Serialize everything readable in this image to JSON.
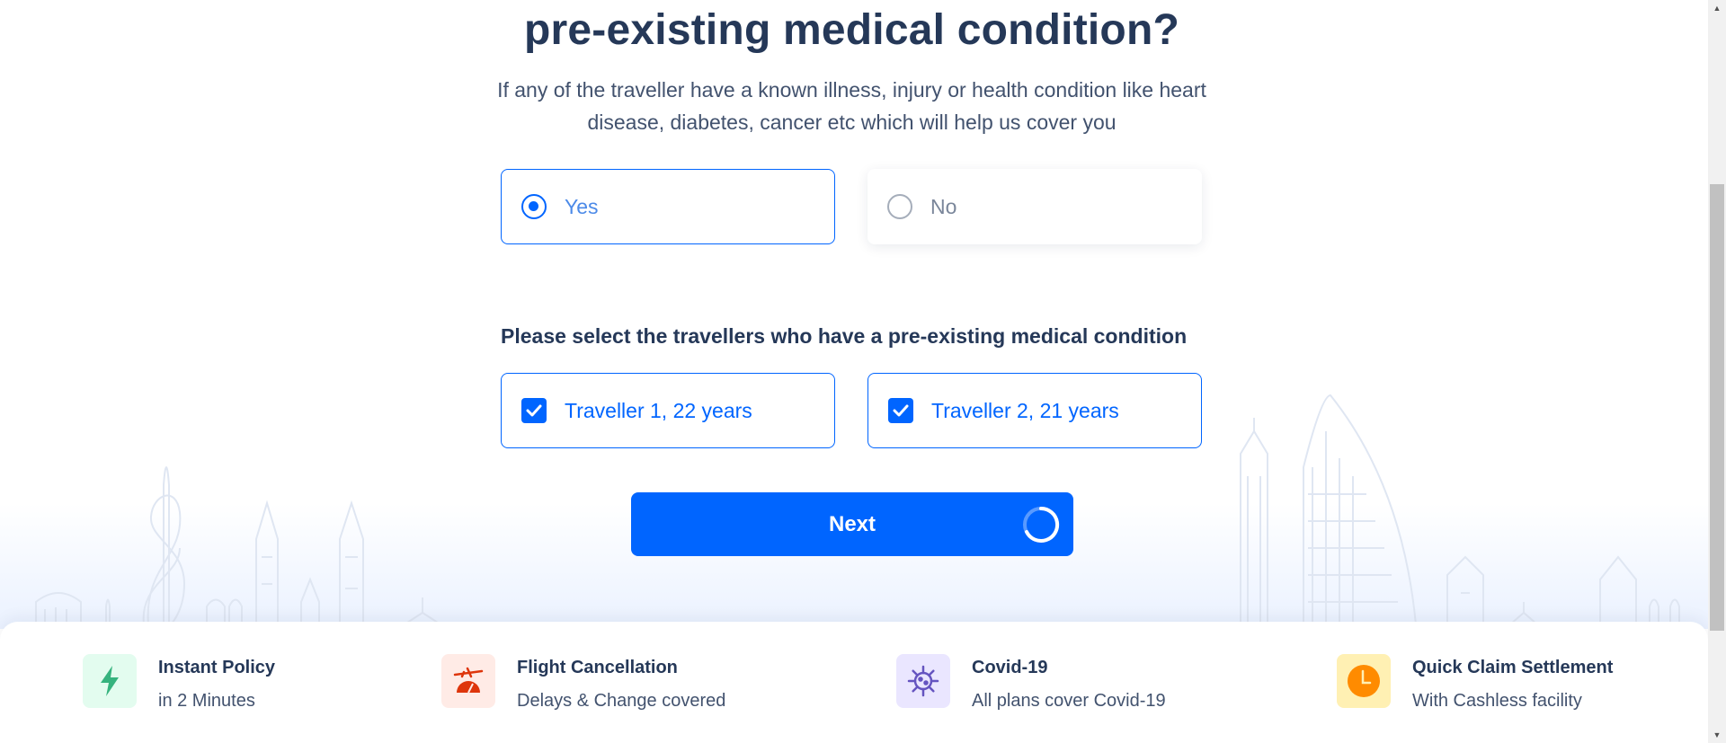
{
  "question": {
    "title": "pre-existing medical condition?",
    "subtitle": "If any of the traveller have a known illness, injury or health condition like heart disease, diabetes, cancer etc which will help us cover you"
  },
  "options": {
    "yes_label": "Yes",
    "no_label": "No",
    "selected": "Yes"
  },
  "travellers": {
    "heading": "Please select the travellers who have a pre-existing medical condition",
    "items": [
      {
        "label": "Traveller 1, 22 years",
        "checked": true
      },
      {
        "label": "Traveller 2, 21 years",
        "checked": true
      }
    ]
  },
  "next_button": {
    "label": "Next",
    "loading": true
  },
  "features": [
    {
      "title": "Instant Policy",
      "subtitle": "in 2 Minutes",
      "icon": "lightning-icon",
      "bg": "#e3fcef",
      "color": "#36b37e"
    },
    {
      "title": "Flight Cancellation",
      "subtitle": "Delays & Change covered",
      "icon": "flight-cancel-icon",
      "bg": "#ffebe6",
      "color": "#de350b"
    },
    {
      "title": "Covid-19",
      "subtitle": "All plans cover Covid-19",
      "icon": "virus-icon",
      "bg": "#eae6ff",
      "color": "#6554c0"
    },
    {
      "title": "Quick Claim Settlement",
      "subtitle": "With Cashless facility",
      "icon": "clock-icon",
      "bg": "#fff0b3",
      "color": "#ff8b00"
    }
  ],
  "colors": {
    "primary": "#0065ff",
    "heading": "#253858",
    "text": "#42526e"
  }
}
